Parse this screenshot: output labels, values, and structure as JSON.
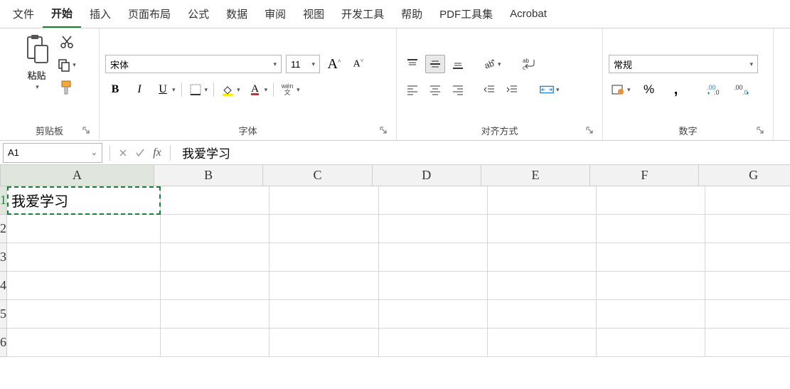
{
  "menu": {
    "items": [
      "文件",
      "开始",
      "插入",
      "页面布局",
      "公式",
      "数据",
      "审阅",
      "视图",
      "开发工具",
      "帮助",
      "PDF工具集",
      "Acrobat"
    ],
    "active_index": 1
  },
  "ribbon": {
    "clipboard": {
      "label": "剪贴板",
      "paste": "粘贴"
    },
    "font": {
      "label": "字体",
      "name": "宋体",
      "size": "11",
      "wen_char": "wén",
      "wen_sub": "文"
    },
    "alignment": {
      "label": "对齐方式"
    },
    "number": {
      "label": "数字",
      "format": "常规"
    }
  },
  "formula_bar": {
    "name_box": "A1",
    "fx_symbol": "fx",
    "value": "我爱学习"
  },
  "grid": {
    "columns": [
      "A",
      "B",
      "C",
      "D",
      "E",
      "F",
      "G"
    ],
    "rows": [
      "1",
      "2",
      "3",
      "4",
      "5",
      "6"
    ],
    "active_cell": {
      "row": 0,
      "col": 0,
      "value": "我爱学习"
    }
  }
}
